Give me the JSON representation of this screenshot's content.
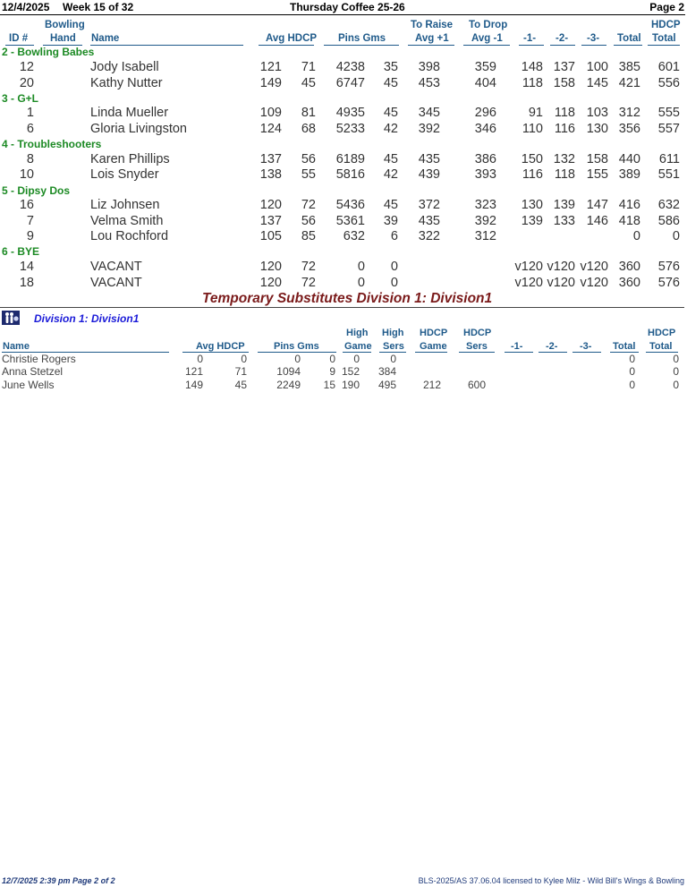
{
  "header": {
    "date": "12/4/2025",
    "week": "Week 15 of 32",
    "title": "Thursday Coffee 25-26",
    "page": "Page 2"
  },
  "columns": {
    "id": "ID #",
    "bowling": "Bowling",
    "hand": "Hand",
    "name": "Name",
    "avg_hdcp": "Avg HDCP",
    "pins_gms": "Pins  Gms",
    "to_raise": "To Raise",
    "avg_plus": "Avg +1",
    "to_drop": "To Drop",
    "avg_minus": "Avg -1",
    "g1": "-1-",
    "g2": "-2-",
    "g3": "-3-",
    "total": "Total",
    "hdcp": "HDCP",
    "hdcp_total": "Total"
  },
  "teams": [
    {
      "label": "2 - Bowling Babes",
      "bowlers": [
        {
          "id": "12",
          "name": "Jody Isabell",
          "avg": "121",
          "hdcp": "71",
          "pins": "4238",
          "gms": "35",
          "raise": "398",
          "drop": "359",
          "g1": "148",
          "g2": "137",
          "g3": "100",
          "total": "385",
          "hdcp_total": "601"
        },
        {
          "id": "20",
          "name": "Kathy Nutter",
          "avg": "149",
          "hdcp": "45",
          "pins": "6747",
          "gms": "45",
          "raise": "453",
          "drop": "404",
          "g1": "118",
          "g2": "158",
          "g3": "145",
          "total": "421",
          "hdcp_total": "556"
        }
      ]
    },
    {
      "label": "3 - G+L",
      "bowlers": [
        {
          "id": "1",
          "name": "Linda Mueller",
          "avg": "109",
          "hdcp": "81",
          "pins": "4935",
          "gms": "45",
          "raise": "345",
          "drop": "296",
          "g1": "91",
          "g2": "118",
          "g3": "103",
          "total": "312",
          "hdcp_total": "555"
        },
        {
          "id": "6",
          "name": "Gloria Livingston",
          "avg": "124",
          "hdcp": "68",
          "pins": "5233",
          "gms": "42",
          "raise": "392",
          "drop": "346",
          "g1": "110",
          "g2": "116",
          "g3": "130",
          "total": "356",
          "hdcp_total": "557"
        }
      ]
    },
    {
      "label": "4 - Troubleshooters",
      "bowlers": [
        {
          "id": "8",
          "name": "Karen Phillips",
          "avg": "137",
          "hdcp": "56",
          "pins": "6189",
          "gms": "45",
          "raise": "435",
          "drop": "386",
          "g1": "150",
          "g2": "132",
          "g3": "158",
          "total": "440",
          "hdcp_total": "611"
        },
        {
          "id": "10",
          "name": "Lois Snyder",
          "avg": "138",
          "hdcp": "55",
          "pins": "5816",
          "gms": "42",
          "raise": "439",
          "drop": "393",
          "g1": "116",
          "g2": "118",
          "g3": "155",
          "total": "389",
          "hdcp_total": "551"
        }
      ]
    },
    {
      "label": "5 - Dipsy Dos",
      "bowlers": [
        {
          "id": "16",
          "name": "Liz Johnsen",
          "avg": "120",
          "hdcp": "72",
          "pins": "5436",
          "gms": "45",
          "raise": "372",
          "drop": "323",
          "g1": "130",
          "g2": "139",
          "g3": "147",
          "total": "416",
          "hdcp_total": "632"
        },
        {
          "id": "7",
          "name": "Velma Smith",
          "avg": "137",
          "hdcp": "56",
          "pins": "5361",
          "gms": "39",
          "raise": "435",
          "drop": "392",
          "g1": "139",
          "g2": "133",
          "g3": "146",
          "total": "418",
          "hdcp_total": "586"
        },
        {
          "id": "9",
          "name": "Lou Rochford",
          "avg": "105",
          "hdcp": "85",
          "pins": "632",
          "gms": "6",
          "raise": "322",
          "drop": "312",
          "g1": "",
          "g2": "",
          "g3": "",
          "total": "0",
          "hdcp_total": "0"
        }
      ]
    },
    {
      "label": "6 - BYE",
      "bowlers": [
        {
          "id": "14",
          "name": "VACANT",
          "avg": "120",
          "hdcp": "72",
          "pins": "0",
          "gms": "0",
          "raise": "",
          "drop": "",
          "g1": "v120",
          "g2": "v120",
          "g3": "v120",
          "total": "360",
          "hdcp_total": "576"
        },
        {
          "id": "18",
          "name": "VACANT",
          "avg": "120",
          "hdcp": "72",
          "pins": "0",
          "gms": "0",
          "raise": "",
          "drop": "",
          "g1": "v120",
          "g2": "v120",
          "g3": "v120",
          "total": "360",
          "hdcp_total": "576"
        }
      ]
    }
  ],
  "subs": {
    "title": "Temporary Substitutes   Division 1: Division1",
    "division_label": "Division 1: Division1",
    "icon": "bowling-pins-icon",
    "columns": {
      "name": "Name",
      "avg_hdcp": "Avg HDCP",
      "pins_gms": "Pins  Gms",
      "high": "High",
      "game": "Game",
      "sers": "Sers",
      "hdcp": "HDCP",
      "g1": "-1-",
      "g2": "-2-",
      "g3": "-3-",
      "total": "Total"
    },
    "rows": [
      {
        "name": "Christie Rogers",
        "avg": "0",
        "hdcp": "0",
        "pins": "0",
        "gms": "0",
        "hg": "0",
        "hs": "0",
        "hdg": "",
        "hds": "",
        "total": "0",
        "hdcp_total": "0"
      },
      {
        "name": "Anna Stetzel",
        "avg": "121",
        "hdcp": "71",
        "pins": "1094",
        "gms": "9",
        "hg": "152",
        "hs": "384",
        "hdg": "",
        "hds": "",
        "total": "0",
        "hdcp_total": "0"
      },
      {
        "name": "June Wells",
        "avg": "149",
        "hdcp": "45",
        "pins": "2249",
        "gms": "15",
        "hg": "190",
        "hs": "495",
        "hdg": "212",
        "hds": "600",
        "total": "0",
        "hdcp_total": "0"
      }
    ]
  },
  "footer": {
    "left": "12/7/2025  2:39 pm  Page 2 of 2",
    "right": "BLS-2025/AS 37.06.04 licensed to Kylee Milz - Wild Bill's Wings & Bowling"
  }
}
